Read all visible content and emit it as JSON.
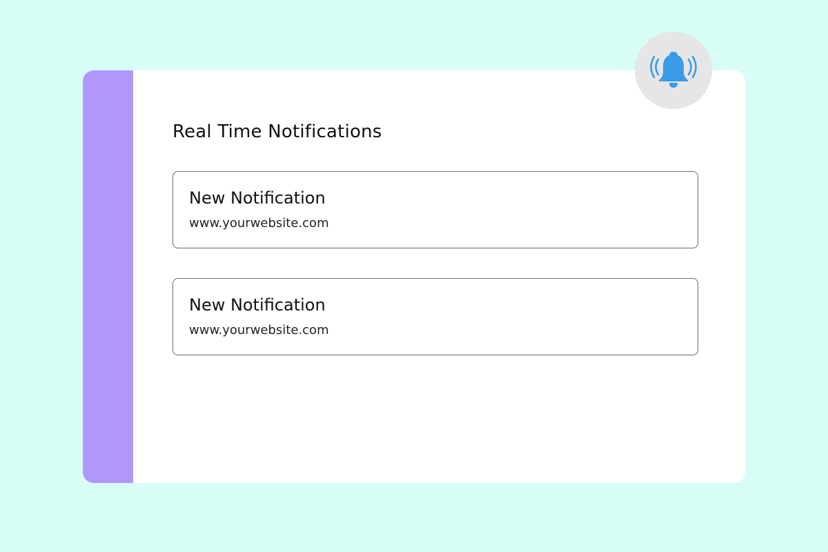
{
  "panel": {
    "title": "Real Time Notifications",
    "accent_color": "#b197fc",
    "background_color": "#d7fdf6"
  },
  "bell": {
    "icon": "ringing-bell-icon",
    "color": "#3a9be6"
  },
  "notifications": [
    {
      "title": "New Notification",
      "url": "www.yourwebsite.com"
    },
    {
      "title": "New Notification",
      "url": "www.yourwebsite.com"
    }
  ]
}
